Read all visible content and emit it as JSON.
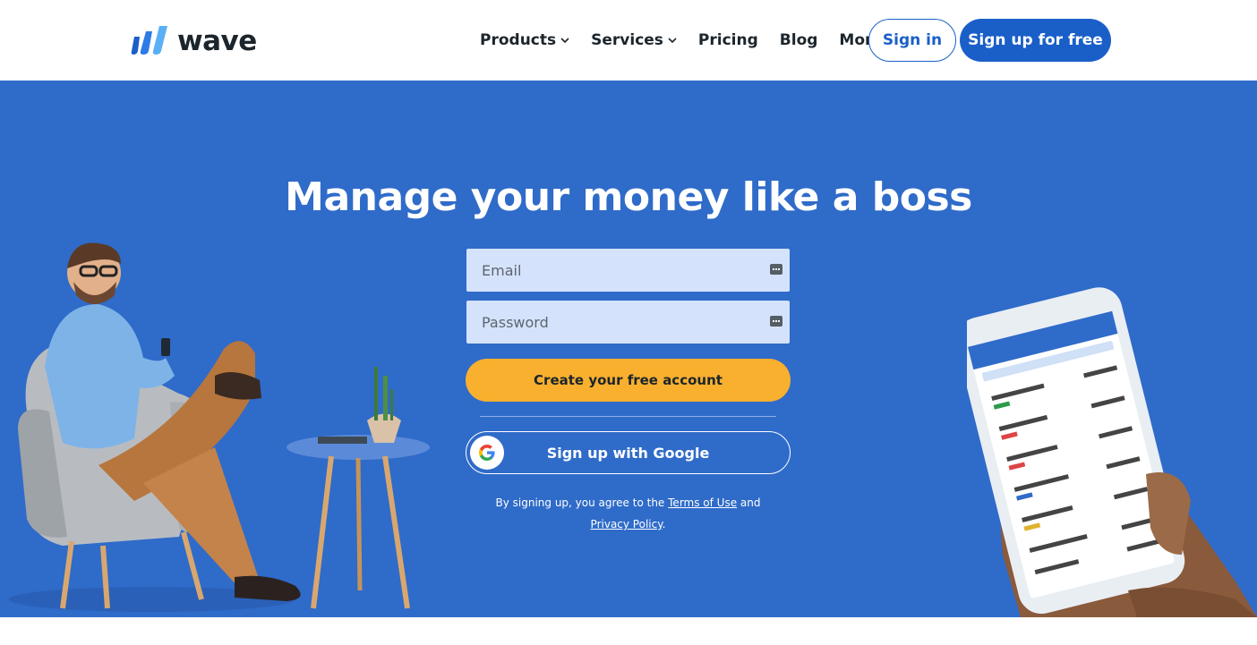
{
  "header": {
    "logo_text": "wave",
    "nav": [
      {
        "label": "Products",
        "has_dropdown": true
      },
      {
        "label": "Services",
        "has_dropdown": true
      },
      {
        "label": "Pricing",
        "has_dropdown": false
      },
      {
        "label": "Blog",
        "has_dropdown": false
      },
      {
        "label": "More",
        "has_dropdown": true
      }
    ],
    "signin_label": "Sign in",
    "signup_label": "Sign up for free"
  },
  "hero": {
    "title": "Manage your money like a boss",
    "email_placeholder": "Email",
    "password_placeholder": "Password",
    "create_account_label": "Create your free account",
    "google_label": "Sign up with Google",
    "legal_prefix": "By signing up, you agree to the",
    "terms_label": "Terms of Use",
    "legal_and": "and",
    "privacy_label": "Privacy Policy",
    "legal_suffix": "."
  },
  "colors": {
    "brand_blue": "#1a5fc8",
    "hero_bg": "#2f6bc9",
    "cta_yellow": "#f9b02e",
    "field_bg": "#d5e2fb"
  },
  "icons": [
    "wave-logo-icon",
    "chevron-down-icon",
    "google-g-icon",
    "password-key-icon"
  ]
}
